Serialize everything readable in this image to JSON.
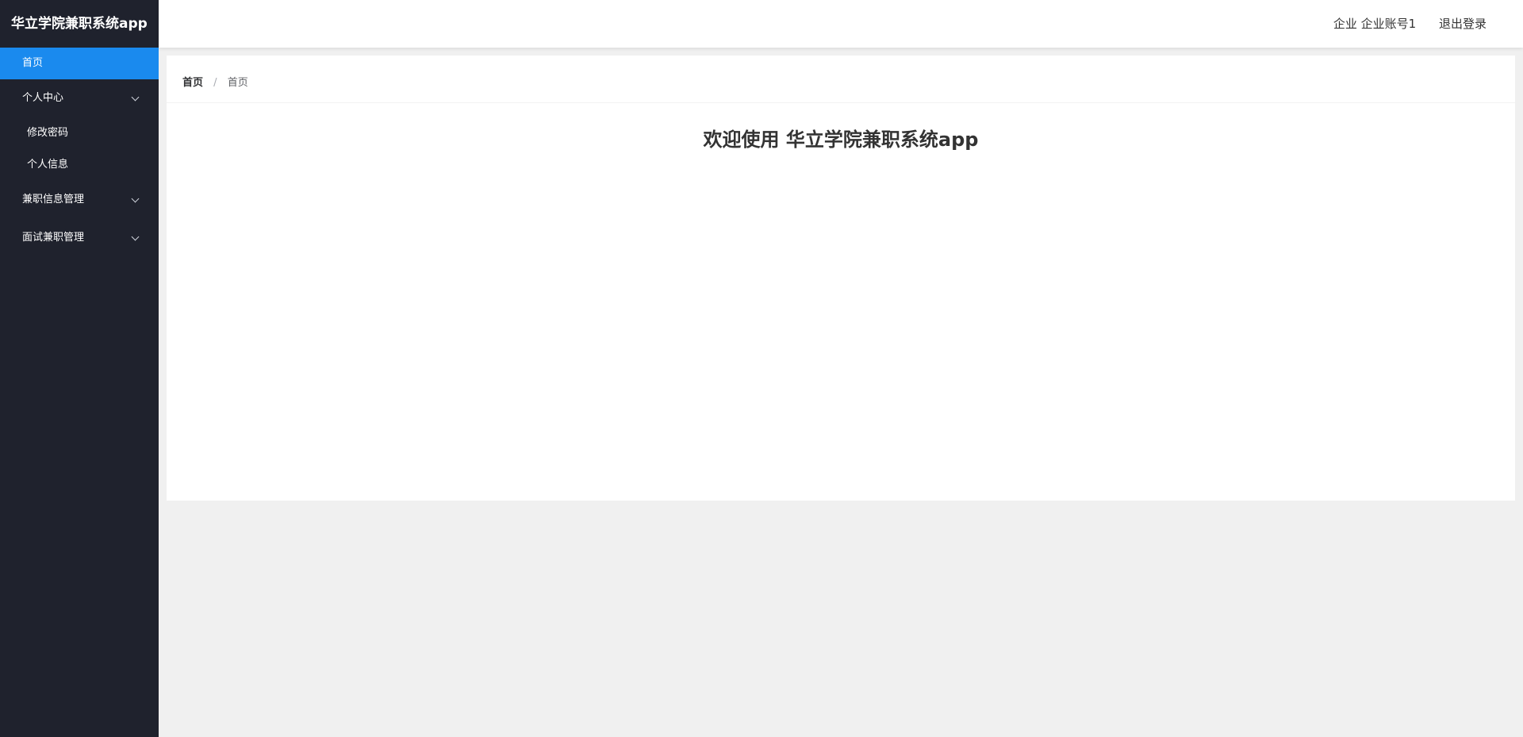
{
  "app": {
    "title": "华立学院兼职系统app"
  },
  "sidebar": {
    "home": "首页",
    "personal_center": {
      "label": "个人中心",
      "items": [
        "修改密码",
        "个人信息"
      ]
    },
    "parttime_info_mgmt": "兼职信息管理",
    "interview_mgmt": "面试兼职管理"
  },
  "header": {
    "user_label": "企业 企业账号1",
    "logout": "退出登录"
  },
  "breadcrumb": {
    "root": "首页",
    "separator": "/",
    "current": "首页"
  },
  "main": {
    "welcome": "欢迎使用 华立学院兼职系统app"
  },
  "colors": {
    "sidebar_bg": "#1f222d",
    "active_item": "#1a8aee",
    "content_bg": "#f0f0f0"
  }
}
